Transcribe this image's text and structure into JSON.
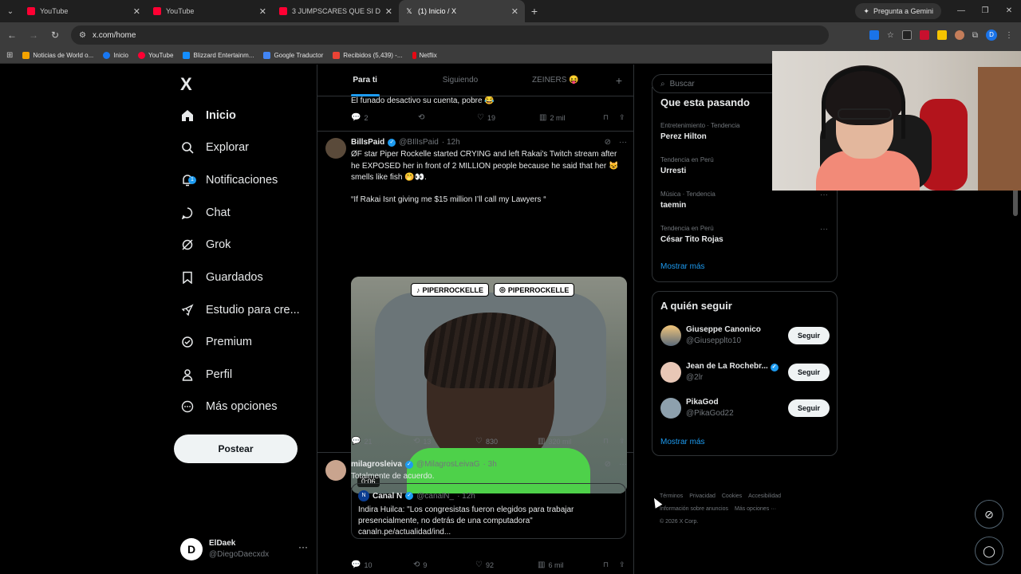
{
  "browser": {
    "tabs": [
      {
        "title": "YouTube",
        "favicon": "youtube-icon"
      },
      {
        "title": "YouTube",
        "favicon": "youtube-icon"
      },
      {
        "title": "3 JUMPSCARES QUE SI DAN M",
        "favicon": "youtube-icon"
      },
      {
        "title": "(1) Inicio / X",
        "favicon": "x-icon",
        "active": true
      }
    ],
    "gemini_label": "Pregunta a Gemini",
    "url": "x.com/home",
    "bookmarks": [
      {
        "label": "Noticias de World o...",
        "color": "#f4a300"
      },
      {
        "label": "Inicio",
        "color": "#1877f2"
      },
      {
        "label": "YouTube",
        "color": "#ff0033"
      },
      {
        "label": "Blizzard Entertainm...",
        "color": "#148eff"
      },
      {
        "label": "Google Traductor",
        "color": "#4285f4"
      },
      {
        "label": "Recibidos (5,439) -...",
        "color": "#ea4335"
      },
      {
        "label": "Netflix",
        "color": "#e50914"
      }
    ],
    "profile_initial": "D"
  },
  "nav": {
    "logo": "X",
    "items": [
      {
        "label": "Inicio",
        "icon": "home-icon",
        "bold": true
      },
      {
        "label": "Explorar",
        "icon": "search-icon"
      },
      {
        "label": "Notificaciones",
        "icon": "bell-icon",
        "badge": "1"
      },
      {
        "label": "Chat",
        "icon": "chat-icon"
      },
      {
        "label": "Grok",
        "icon": "grok-icon"
      },
      {
        "label": "Guardados",
        "icon": "bookmark-icon"
      },
      {
        "label": "Estudio para cre...",
        "icon": "rocket-icon"
      },
      {
        "label": "Premium",
        "icon": "premium-icon"
      },
      {
        "label": "Perfil",
        "icon": "person-icon"
      },
      {
        "label": "Más opciones",
        "icon": "more-circle-icon"
      }
    ],
    "post_button": "Postear",
    "account": {
      "name": "ElDaek",
      "handle": "@DiegoDaecxdx",
      "more": "···"
    }
  },
  "feed": {
    "tabs": [
      "Para ti",
      "Siguiendo",
      "ZEINERS 😝"
    ],
    "add_tab": "+",
    "top_tweet": {
      "text": "El funado desactivo su cuenta, pobre 😂",
      "replies": "2",
      "reposts": "",
      "likes": "19",
      "views": "2 mil"
    },
    "tweet1": {
      "name": "BillsPaid",
      "handle": "@BIlIsPaid",
      "time": "· 12h",
      "text": "ØF star Piper Rockelle started CRYING and left Rakai's Twitch stream after he EXPOSED her in front of 2 MILLION people because he said that her 😺 smells like fish 🤭👀.",
      "quote_line": "“If Rakai Isnt giving me $15 million I’ll call my Lawyers “",
      "media_tags": [
        "PIPERROCKELLE",
        "PIPERROCKELLE"
      ],
      "duration": "0:06",
      "replies": "21",
      "reposts": "13",
      "likes": "830",
      "views": "320 mil"
    },
    "tweet2": {
      "name": "milagrosleiva",
      "handle": "@MilagrosLeivaG",
      "time": "· 3h",
      "text": "Totalmente de acuerdo.",
      "quoted": {
        "name": "Canal N",
        "handle": "@canalN_",
        "time": "· 12h",
        "avatar_letter": "N",
        "text": "Indira Huilca: \"Los congresistas fueron elegidos para trabajar presencialmente, no detrás de una computadora\" canaln.pe/actualidad/ind..."
      },
      "replies": "10",
      "reposts": "9",
      "likes": "92",
      "views": "6 mil"
    }
  },
  "sidebar": {
    "search_placeholder": "Buscar",
    "trends_title": "Que esta pasando",
    "trends": [
      {
        "meta": "Entretenimiento · Tendencia",
        "name": "Perez Hilton"
      },
      {
        "meta": "Tendencia en Perú",
        "name": "Urresti"
      },
      {
        "meta": "Música · Tendencia",
        "name": "taemin"
      },
      {
        "meta": "Tendencia en Perú",
        "name": "César Tito Rojas"
      }
    ],
    "trends_more": "Mostrar más",
    "who_title": "A quién seguir",
    "who": [
      {
        "name": "Giuseppe Canonico",
        "handle": "@Giusepplto10",
        "verified": false
      },
      {
        "name": "Jean de La Rochebr...",
        "handle": "@2lr",
        "verified": true
      },
      {
        "name": "PikaGod",
        "handle": "@PikaGod22",
        "verified": false
      }
    ],
    "follow_label": "Seguir",
    "who_more": "Mostrar más",
    "footer": [
      "Términos",
      "Privacidad",
      "Cookies",
      "Accesibilidad",
      "Información sobre anuncios",
      "Más opciones ···",
      "© 2026 X Corp."
    ]
  },
  "colors": {
    "accent": "#1d9bf0",
    "background": "#000000"
  }
}
